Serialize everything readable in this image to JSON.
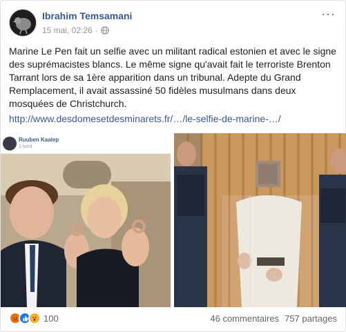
{
  "post": {
    "author": "Ibrahim Temsamani",
    "date": "15 mai, 02:26",
    "date_separator": "·",
    "privacy_icon": "globe-icon",
    "more_label": "···",
    "text": "Marine Le Pen fait un selfie avec un militant radical estonien et avec le signe des suprémacistes blancs. Le même signe qu'avait fait le terroriste Brenton Tarrant lors de sa 1ère apparition dans un tribunal. Adepte du Grand Remplacement, il avait assassiné 50 fidèles musulmans dans deux mosquées de Christchurch.",
    "link": "http://www.desdomesetdesminarets.fr/…/le-selfie-de-marine-…/"
  },
  "embed": {
    "name": "Ruuben Kaalep",
    "time": "1 tund"
  },
  "footer": {
    "reactions": [
      "angry-icon",
      "like-icon",
      "wow-icon"
    ],
    "reaction_count": "100",
    "comments": "46 commentaires",
    "shares": "757 partages"
  },
  "colors": {
    "link": "#385898",
    "muted": "#90949c",
    "angry": "#e9710f",
    "like": "#1877f2",
    "wow": "#f7b125"
  }
}
